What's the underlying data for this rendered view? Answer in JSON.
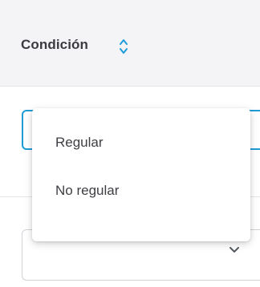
{
  "table": {
    "column_header": "Condición"
  },
  "dropdown": {
    "options": [
      {
        "label": "Regular"
      },
      {
        "label": "No regular"
      }
    ]
  },
  "colors": {
    "focus_border": "#1e9bd8",
    "sort_icon": "#1e9bd8",
    "header_bg": "#f4f4f6"
  },
  "icons": {
    "sort": "sort-icon",
    "chevron": "chevron-down-icon"
  }
}
